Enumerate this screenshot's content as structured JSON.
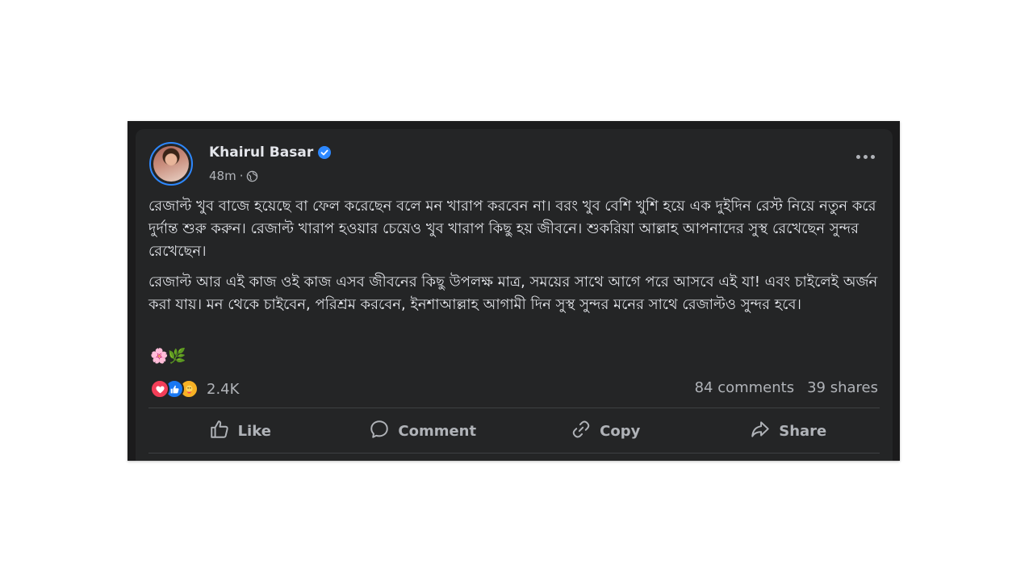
{
  "post": {
    "author": "Khairul Basar",
    "time": "48m",
    "separator": "·",
    "paragraphs": [
      "রেজাল্ট খুব বাজে হয়েছে বা ফেল করেছেন বলে মন খারাপ করবেন না। বরং খুব বেশি খুশি হয়ে এক দুইদিন রেস্ট নিয়ে নতুন করে দুর্দান্ত শুরু করুন। রেজাল্ট খারাপ হওয়ার চেয়েও খুব খারাপ কিছু হয় জীবনে। শুকরিয়া আল্লাহ আপনাদের সুস্থ রেখেছেন সুন্দর রেখেছেন।",
      "রেজাল্ট আর এই কাজ ওই কাজ এসব জীবনের কিছু উপলক্ষ মাত্র, সময়ের সাথে আগে পরে আসবে এই যা! এবং চাইলেই অর্জন করা যায়। মন থেকে চাইবেন, পরিশ্রম করবেন, ইনশাআল্লাহ আগামী দিন সুস্থ সুন্দর মনের সাথে রেজাল্টও সুন্দর হবে।"
    ],
    "emojis": "🌸🌿"
  },
  "reactions": {
    "count": "2.4K",
    "types": [
      "love-icon",
      "like-icon",
      "care-icon"
    ]
  },
  "stats": {
    "comments": "84 comments",
    "shares": "39 shares"
  },
  "actions": {
    "like": "Like",
    "comment": "Comment",
    "copy": "Copy",
    "share": "Share"
  },
  "colors": {
    "background": "#242526",
    "text": "#e4e6eb",
    "secondary": "#b0b3b8",
    "accent": "#2d88ff"
  }
}
